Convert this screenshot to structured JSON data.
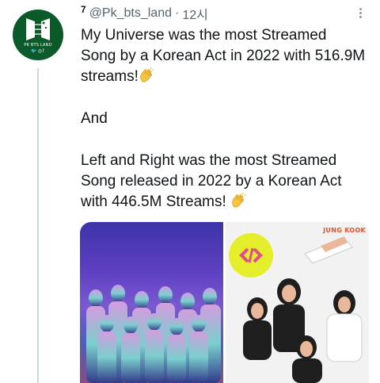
{
  "tweet": {
    "reply_count": "7",
    "handle": "@Pk_bts_land",
    "separator": "·",
    "time": "12시",
    "more_icon": "more-vertical-icon",
    "avatar": {
      "text": "PK BTS LAND",
      "icons": "🐦◎f",
      "background": "#0b5a2a"
    },
    "lines": [
      "My Universe was the most Streamed Song by a Korean Act in 2022 with 516.9M streams!",
      "And",
      "Left and Right was the most Streamed Song released in 2022 by a Korean Act with 446.5M Streams!"
    ],
    "clap_icon": "clapping-hands-icon",
    "media": {
      "left_image": "group-photo-my-universe",
      "right_image": "left-and-right-cover",
      "right_caption": "JUNG KOOK"
    }
  },
  "colors": {
    "text": "#0f1419",
    "secondary": "#536471",
    "thread_line": "#cfd9de"
  }
}
